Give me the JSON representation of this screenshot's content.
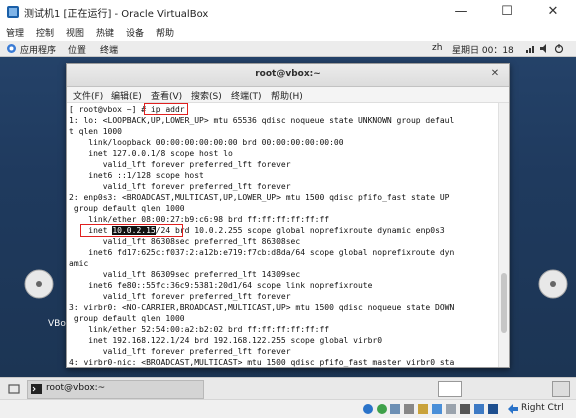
{
  "window": {
    "title": "测试机1 [正在运行] - Oracle VirtualBox",
    "minimize_glyph": "—",
    "restore_glyph": "☐",
    "close_glyph": "✕"
  },
  "vb_menu": [
    "管理",
    "控制",
    "视图",
    "热键",
    "设备",
    "帮助"
  ],
  "guest_topbar": {
    "apps": "应用程序",
    "places": "位置",
    "terminal": "终端",
    "lang": "zh",
    "clock": "星期日 00：18"
  },
  "desktop": {
    "vbox_label": "VBo"
  },
  "terminal": {
    "title": "root@vbox:~",
    "close_glyph": "✕",
    "menu": [
      "文件(F)",
      "编辑(E)",
      "查看(V)",
      "搜索(S)",
      "终端(T)",
      "帮助(H)"
    ],
    "prompt": "[ root@vbox ~] # ",
    "command": "ip addr",
    "inet_prefix": "    inet ",
    "inet_ip": "10.0.2.15",
    "inet_rest": "/24 brd 10.0.2.255 scope global noprefixroute dynamic enp0s3",
    "lines": [
      "1: lo: <LOOPBACK,UP,LOWER_UP> mtu 65536 qdisc noqueue state UNKNOWN group defaul",
      "t qlen 1000",
      "    link/loopback 00:00:00:00:00:00 brd 00:00:00:00:00:00",
      "    inet 127.0.0.1/8 scope host lo",
      "       valid_lft forever preferred_lft forever",
      "    inet6 ::1/128 scope host",
      "       valid_lft forever preferred_lft forever",
      "2: enp0s3: <BROADCAST,MULTICAST,UP,LOWER_UP> mtu 1500 qdisc pfifo_fast state UP",
      " group default qlen 1000",
      "    link/ether 08:00:27:b9:c6:98 brd ff:ff:ff:ff:ff:ff",
      "       valid_lft 86308sec preferred_lft 86308sec",
      "    inet6 fd17:625c:f037:2:a12b:e719:f7cb:d8da/64 scope global noprefixroute dyn",
      "amic",
      "       valid_lft 86309sec preferred_lft 14309sec",
      "    inet6 fe80::55fc:36c9:5381:20d1/64 scope link noprefixroute",
      "       valid_lft forever preferred_lft forever",
      "3: virbr0: <NO-CARRIER,BROADCAST,MULTICAST,UP> mtu 1500 qdisc noqueue state DOWN",
      " group default qlen 1000",
      "    link/ether 52:54:00:a2:b2:02 brd ff:ff:ff:ff:ff:ff",
      "    inet 192.168.122.1/24 brd 192.168.122.255 scope global virbr0",
      "       valid_lft forever preferred_lft forever",
      "4: virbr0-nic: <BROADCAST,MULTICAST> mtu 1500 qdisc pfifo_fast master virbr0 sta"
    ]
  },
  "taskbar": {
    "item": "root@vbox:~"
  },
  "statusbar": {
    "hostkey": "Right Ctrl"
  },
  "colors": {
    "highlight_box": "#e0201f",
    "desktop": "#25436a"
  }
}
